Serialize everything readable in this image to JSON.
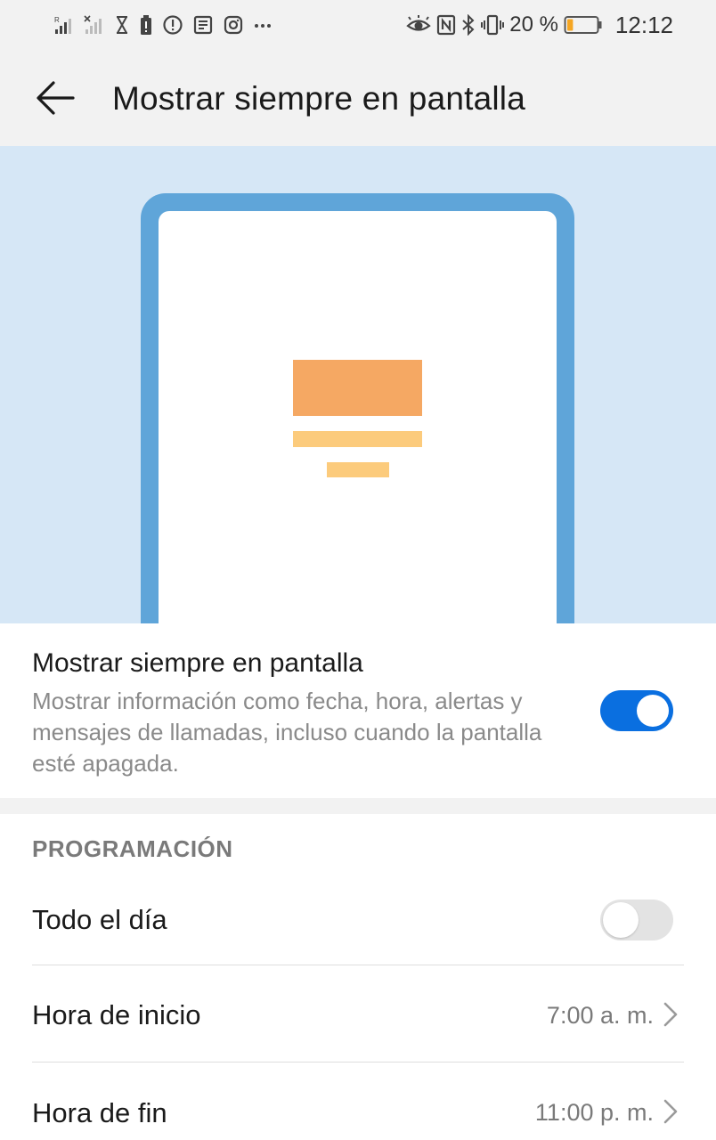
{
  "status_bar": {
    "battery_percent": "20 %",
    "battery_level": 0.2,
    "time": "12:12",
    "icons_left": [
      "signal-r-icon",
      "signal-x-icon",
      "hourglass-icon",
      "battery-saver-icon",
      "alert-icon",
      "news-icon",
      "instagram-icon",
      "more-dots-icon"
    ],
    "icons_right": [
      "eye-icon",
      "nfc-icon",
      "bluetooth-icon",
      "vibrate-icon",
      "battery-icon"
    ]
  },
  "app_bar": {
    "title": "Mostrar siempre en pantalla"
  },
  "main_setting": {
    "title": "Mostrar siempre en pantalla",
    "description": "Mostrar información como fecha, hora, alertas y mensajes de llamadas, incluso cuando la pantalla esté apagada.",
    "enabled": true
  },
  "schedule": {
    "header": "PROGRAMACIÓN",
    "items": [
      {
        "label": "Todo el día",
        "type": "toggle",
        "enabled": false
      },
      {
        "label": "Hora de inicio",
        "type": "value",
        "value": "7:00 a. m."
      },
      {
        "label": "Hora de fin",
        "type": "value",
        "value": "11:00 p. m."
      }
    ]
  },
  "colors": {
    "accent": "#0a6fe0",
    "illustration_bg": "#d6e7f6",
    "phone_frame": "#5fa5d9",
    "clock_block": "#f5a863",
    "date_lines": "#fccb7c"
  }
}
